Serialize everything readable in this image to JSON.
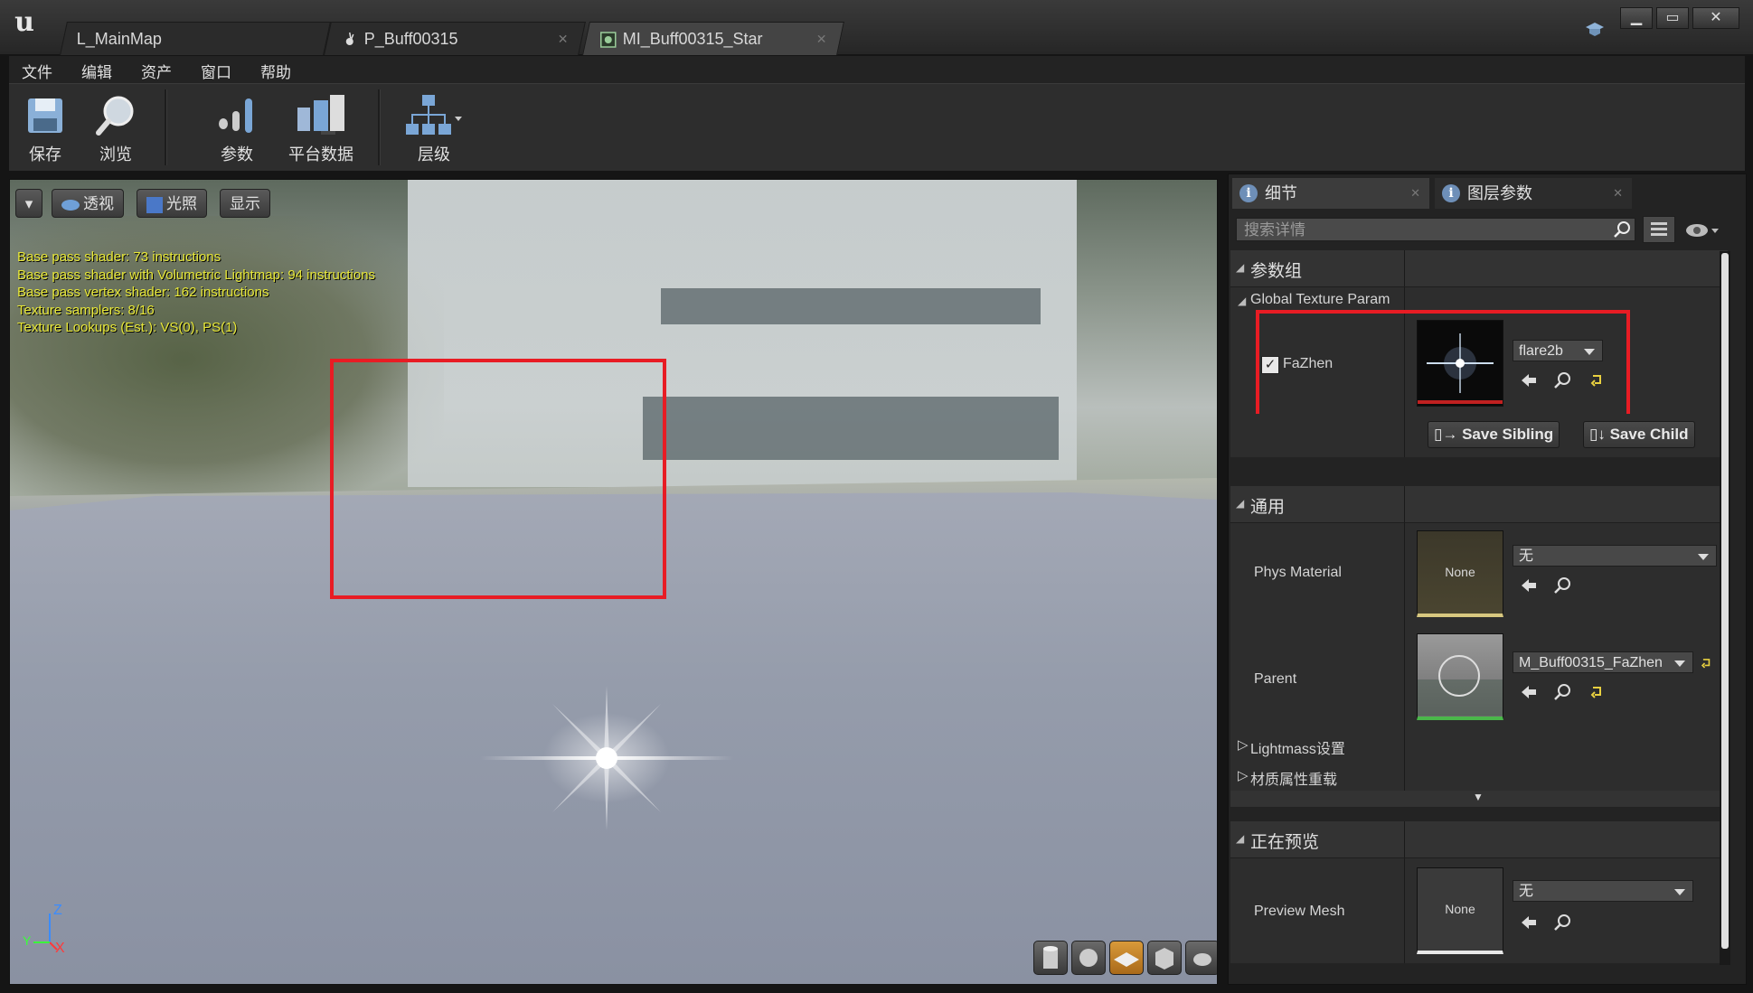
{
  "tabs": [
    {
      "label": "L_MainMap"
    },
    {
      "label": "P_Buff00315"
    },
    {
      "label": "MI_Buff00315_Star"
    }
  ],
  "window": {
    "minimize": "▁",
    "maximize": "▭",
    "close": "✕"
  },
  "menu": [
    "文件",
    "编辑",
    "资产",
    "窗口",
    "帮助"
  ],
  "toolbar": {
    "save": "保存",
    "browse": "浏览",
    "params": "参数",
    "platform_data": "平台数据",
    "hierarchy": "层级"
  },
  "viewport": {
    "buttons": {
      "perspective": "透视",
      "lighting": "光照",
      "show": "显示"
    },
    "stats": [
      "Base pass shader: 73 instructions",
      "Base pass shader with Volumetric Lightmap: 94 instructions",
      "Base pass vertex shader: 162 instructions",
      "Texture samplers: 8/16",
      "Texture Lookups (Est.): VS(0), PS(1)"
    ],
    "axis": {
      "z": "Z",
      "x": "X",
      "y": "Y"
    }
  },
  "details": {
    "tab_details": "细节",
    "tab_layer_params": "图层参数",
    "search_placeholder": "搜索详情",
    "param_group": "参数组",
    "global_texture_param": "Global Texture Param",
    "fazhen_label": "FaZhen",
    "fazhen_checked": true,
    "fazhen_texture": "flare2b",
    "save_sibling": "Save Sibling",
    "save_child": "Save Child",
    "general": "通用",
    "phys_material_label": "Phys Material",
    "phys_material_thumb": "None",
    "phys_material_value": "无",
    "parent_label": "Parent",
    "parent_value": "M_Buff00315_FaZhen",
    "lightmass": "Lightmass设置",
    "material_override": "材质属性重载",
    "previewing": "正在预览",
    "preview_mesh_label": "Preview Mesh",
    "preview_mesh_thumb": "None",
    "preview_mesh_value": "无"
  },
  "colors": {
    "highlight_red": "#e81c24",
    "stats_yellow": "#e8e838",
    "active_view_orange": "#d99a3a"
  }
}
